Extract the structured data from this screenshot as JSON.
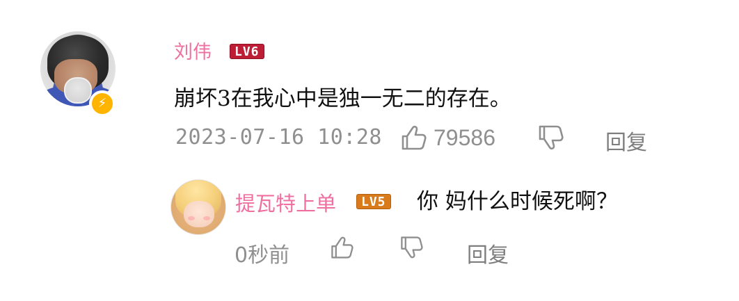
{
  "comment": {
    "username": "刘伟",
    "level_badge": "LV6",
    "text": "崩坏3在我心中是独一无二的存在。",
    "timestamp": "2023-07-16 10:28",
    "likes": "79586",
    "reply_label": "回复",
    "verified_icon": "lightning-bolt-icon"
  },
  "reply": {
    "username": "提瓦特上单",
    "level_badge": "LV5",
    "text": "你 妈什么时候死啊？",
    "time_ago": "0秒前",
    "reply_label": "回复"
  },
  "colors": {
    "username_pink": "#ef6fa0",
    "lv6_red": "#bd1e35",
    "lv5_orange": "#d97b1a",
    "meta_gray": "#8f8f8f",
    "verified_yellow": "#ffb400"
  },
  "icons": {
    "like": "thumb-up-icon",
    "dislike": "thumb-down-icon"
  }
}
